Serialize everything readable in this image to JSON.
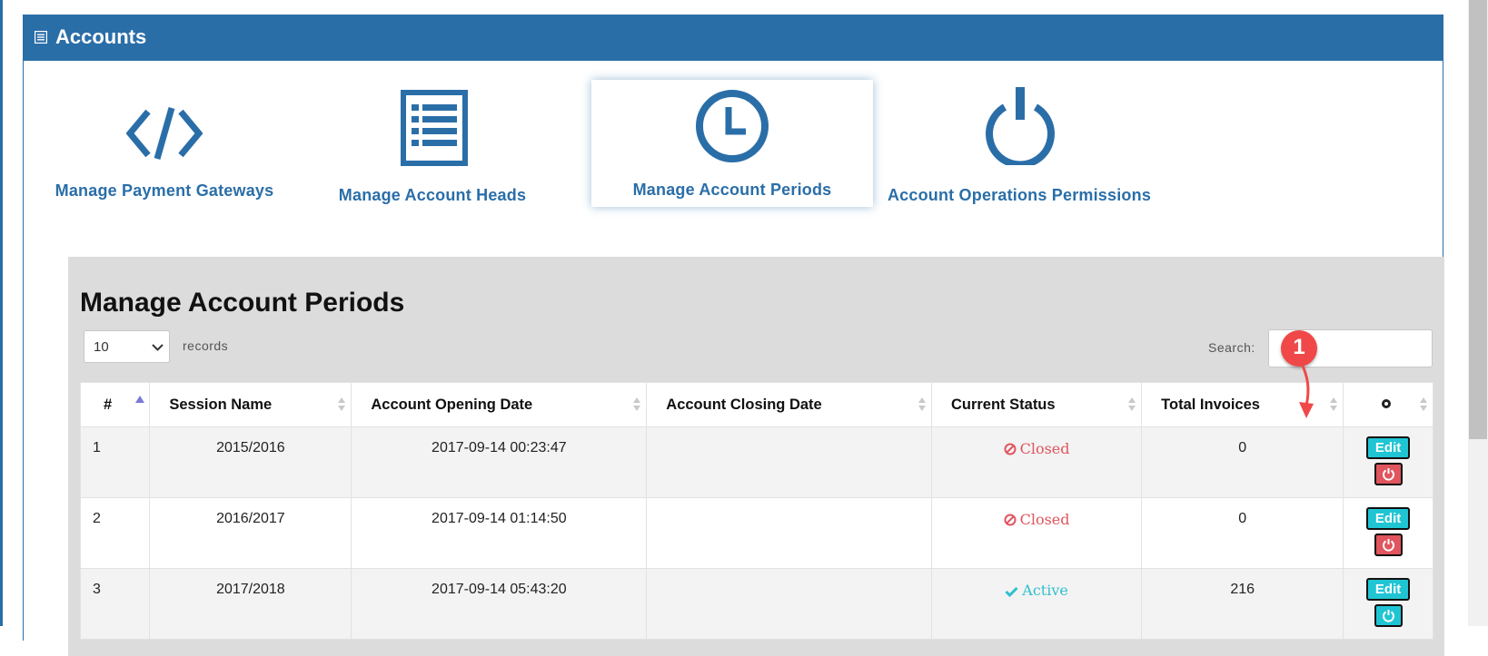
{
  "panel": {
    "title": "Accounts"
  },
  "tiles": [
    {
      "label": "Manage Payment Gateways",
      "icon": "code-icon"
    },
    {
      "label": "Manage Account Heads",
      "icon": "list-icon"
    },
    {
      "label": "Manage Account Periods",
      "icon": "clock-icon",
      "active": true
    },
    {
      "label": "Account Operations Permissions",
      "icon": "power-icon"
    }
  ],
  "section": {
    "heading": "Manage Account Periods",
    "page_length": "10",
    "records_label": "records",
    "search_label": "Search:",
    "search_value": ""
  },
  "table": {
    "columns": [
      "#",
      "Session Name",
      "Account Opening Date",
      "Account Closing Date",
      "Current Status",
      "Total Invoices",
      ""
    ],
    "rows": [
      {
        "num": "1",
        "session": "2015/2016",
        "opening": "2017-09-14 00:23:47",
        "closing": "",
        "status": "Closed",
        "invoices": "0",
        "edit": "Edit",
        "toggle": "red"
      },
      {
        "num": "2",
        "session": "2016/2017",
        "opening": "2017-09-14 01:14:50",
        "closing": "",
        "status": "Closed",
        "invoices": "0",
        "edit": "Edit",
        "toggle": "red"
      },
      {
        "num": "3",
        "session": "2017/2018",
        "opening": "2017-09-14 05:43:20",
        "closing": "",
        "status": "Active",
        "invoices": "216",
        "edit": "Edit",
        "toggle": "teal"
      }
    ]
  },
  "callout": {
    "number": "1"
  },
  "colors": {
    "brand": "#2a6ea8",
    "closed": "#e0555e",
    "active": "#2fbfcf",
    "edit": "#20c5d3",
    "callout": "#f04848"
  }
}
